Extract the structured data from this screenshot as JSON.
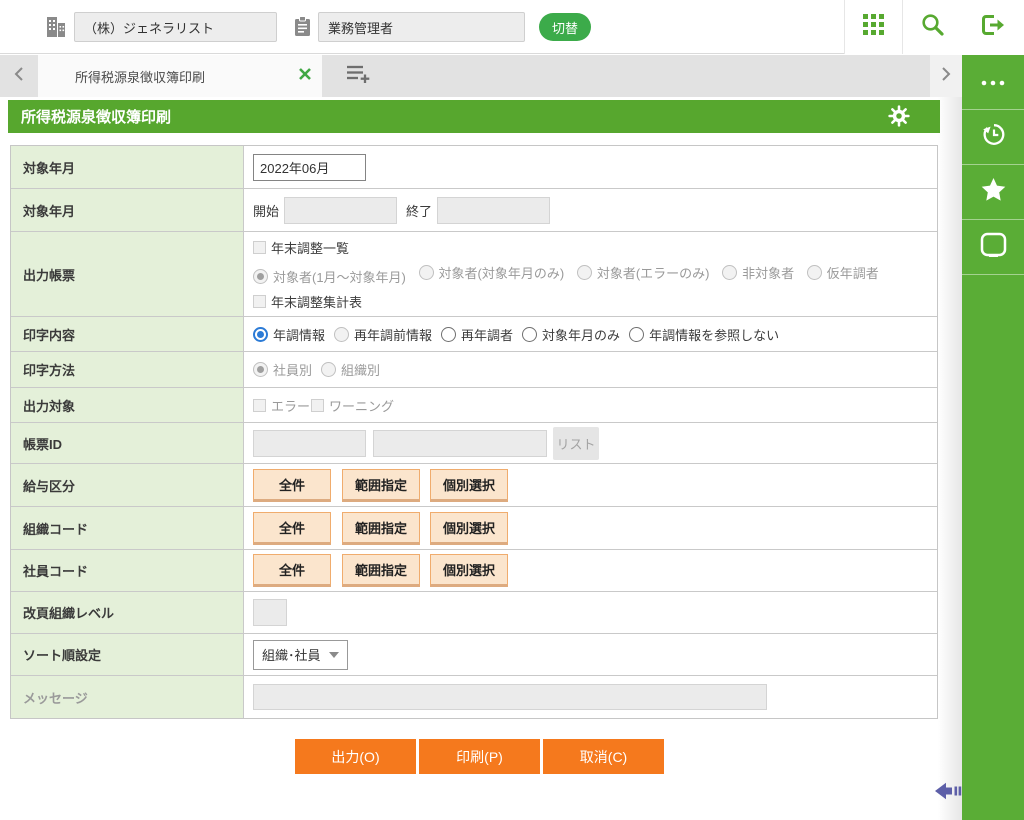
{
  "header": {
    "company_value": "（株）ジェネラリスト",
    "role_value": "業務管理者",
    "switch_button_label": "切替"
  },
  "tab_bar": {
    "active_tab_title": "所得税源泉徴収簿印刷"
  },
  "page": {
    "title": "所得税源泉徴収簿印刷"
  },
  "form": {
    "target_month": {
      "label": "対象年月",
      "value": "2022年06月"
    },
    "target_period": {
      "label": "対象年月",
      "start_label": "開始",
      "end_label": "終了"
    },
    "output_report": {
      "label": "出力帳票",
      "yearend_list_checkbox": "年末調整一覧",
      "target_options": [
        "対象者(1月～対象年月)",
        "対象者(対象年月のみ)",
        "対象者(エラーのみ)",
        "非対象者",
        "仮年調者"
      ],
      "yearend_summary_checkbox": "年末調整集計表"
    },
    "print_content": {
      "label": "印字内容",
      "options": [
        "年調情報",
        "再年調前情報",
        "再年調者",
        "対象年月のみ",
        "年調情報を参照しない"
      ]
    },
    "print_method": {
      "label": "印字方法",
      "options": [
        "社員別",
        "組織別"
      ]
    },
    "output_target": {
      "label": "出力対象",
      "options": [
        "エラー",
        "ワーニング"
      ]
    },
    "report_id": {
      "label": "帳票ID",
      "list_button_label": "リスト"
    },
    "salary_class": {
      "label": "給与区分",
      "all_button": "全件",
      "range_button": "範囲指定",
      "select_button": "個別選択"
    },
    "org_code": {
      "label": "組織コード",
      "all_button": "全件",
      "range_button": "範囲指定",
      "select_button": "個別選択"
    },
    "employee_code": {
      "label": "社員コード",
      "all_button": "全件",
      "range_button": "範囲指定",
      "select_button": "個別選択"
    },
    "page_break_org_level": {
      "label": "改頁組織レベル"
    },
    "sort_order": {
      "label": "ソート順設定",
      "value": "組織･社員"
    },
    "message": {
      "label": "メッセージ"
    }
  },
  "actions": {
    "output_button": "出力(O)",
    "print_button": "印刷(P)",
    "cancel_button": "取消(C)"
  },
  "colors": {
    "brand_green": "#57a72e",
    "sidebar_green": "#5aad36",
    "accent_green": "#3cab4a",
    "action_orange": "#f5791d",
    "cream_button_bg": "#fbe5cd",
    "label_column_bg": "#e4f0d9",
    "selected_radio_blue": "#2c7bd6",
    "collapse_arrow_purple": "#5d5fa8"
  }
}
